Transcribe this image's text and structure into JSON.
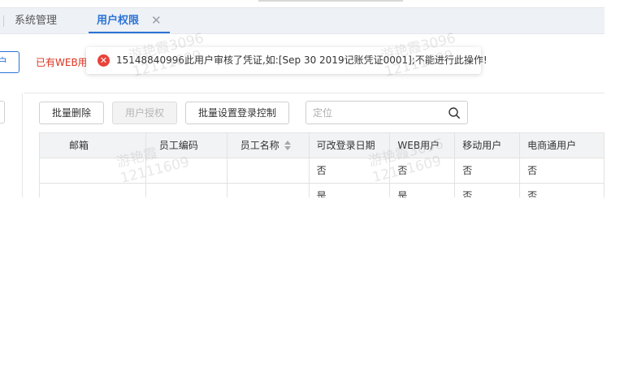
{
  "tabs": [
    {
      "label": "系统管理",
      "active": false
    },
    {
      "label": "用户权限",
      "active": true,
      "close_glyph": "✕"
    }
  ],
  "left_button": {
    "label": "户"
  },
  "web_notice": "已有WEB用",
  "toast": {
    "type": "error",
    "icon": "error-circle-icon",
    "icon_glyph": "✕",
    "message": "15148840996此用户审核了凭证,如:[Sep 30 2019记账凭证0001];不能进行此操作!"
  },
  "toolbar": {
    "batch_delete": "批量删除",
    "user_authorize": "用户授权",
    "batch_login_control": "批量设置登录控制",
    "search_placeholder": "定位"
  },
  "table": {
    "columns": [
      "邮箱",
      "员工编码",
      "员工名称",
      "可改登录日期",
      "WEB用户",
      "移动用户",
      "电商通用户"
    ],
    "rows": [
      [
        "",
        "",
        "",
        "否",
        "否",
        "否",
        "否"
      ],
      [
        "",
        "",
        "",
        "是",
        "是",
        "否",
        "否"
      ]
    ]
  },
  "watermark": {
    "name": "游艳霞",
    "code": "3096",
    "id": "12111609"
  },
  "colors": {
    "accent": "#2b73d6",
    "error": "#e8433a",
    "notice_red": "#e0301e"
  }
}
